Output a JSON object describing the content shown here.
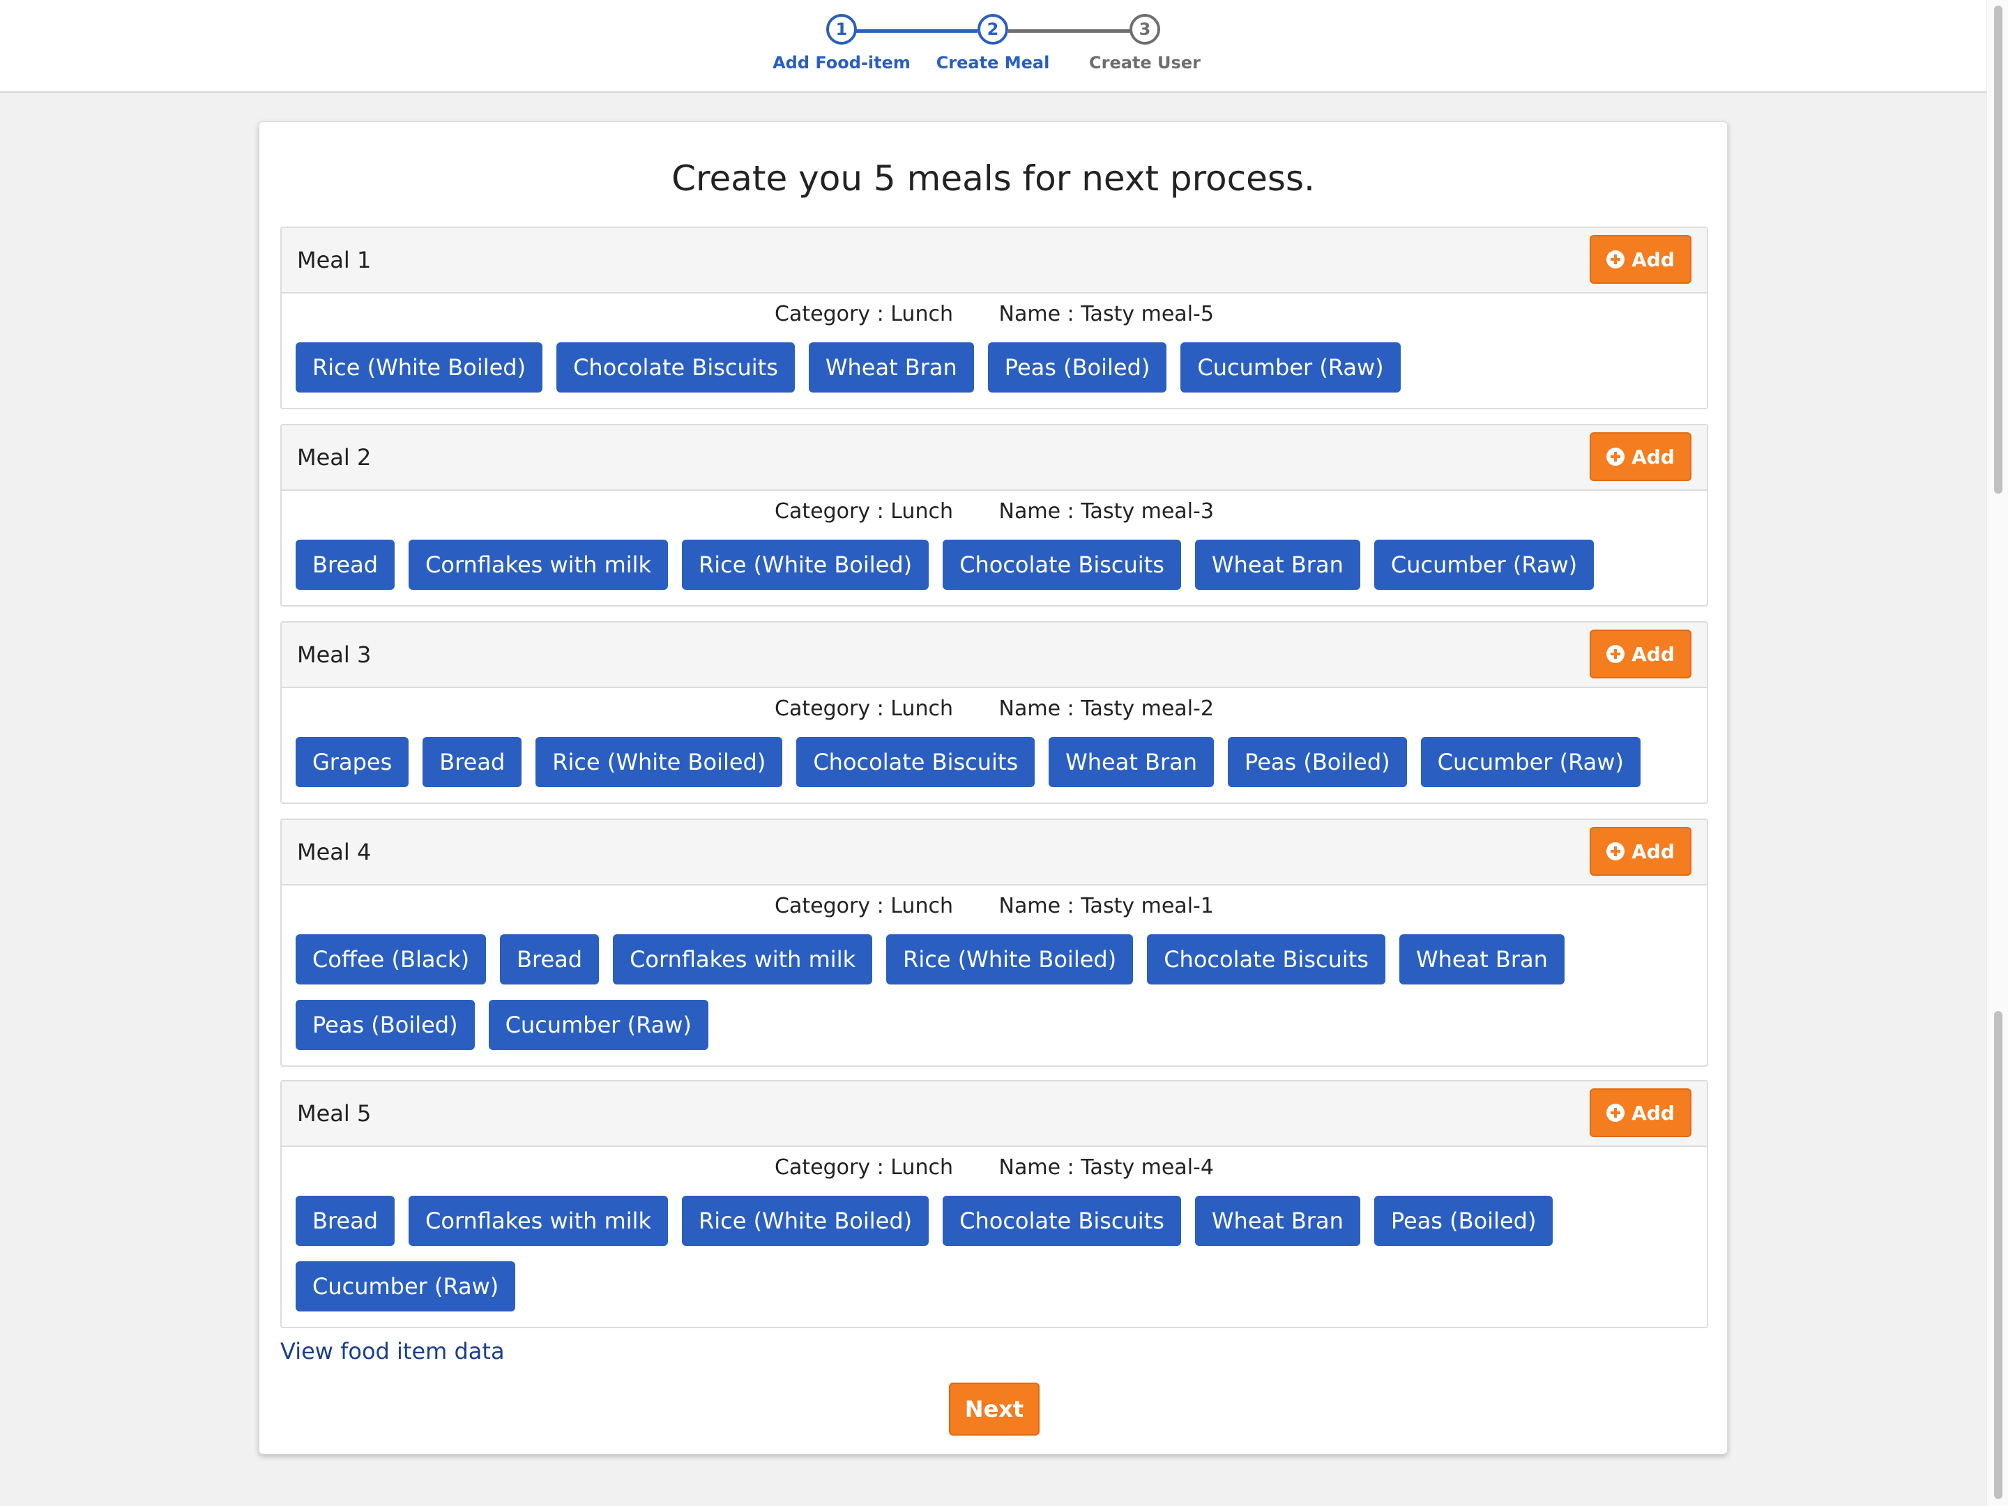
{
  "stepper": {
    "steps": [
      {
        "number": "1",
        "label": "Add Food-item",
        "state": "completed"
      },
      {
        "number": "2",
        "label": "Create Meal",
        "state": "active"
      },
      {
        "number": "3",
        "label": "Create User",
        "state": "inactive"
      }
    ]
  },
  "page": {
    "title": "Create you 5 meals for next process.",
    "add_label": "Add",
    "view_link": "View food item data",
    "next_label": "Next"
  },
  "meals": [
    {
      "title": "Meal 1",
      "category": "Category : Lunch",
      "name": "Name : Tasty meal-5",
      "items": [
        "Rice (White Boiled)",
        "Chocolate Biscuits",
        "Wheat Bran",
        "Peas (Boiled)",
        "Cucumber (Raw)"
      ]
    },
    {
      "title": "Meal 2",
      "category": "Category : Lunch",
      "name": "Name : Tasty meal-3",
      "items": [
        "Bread",
        "Cornflakes with milk",
        "Rice (White Boiled)",
        "Chocolate Biscuits",
        "Wheat Bran",
        "Cucumber (Raw)"
      ]
    },
    {
      "title": "Meal 3",
      "category": "Category : Lunch",
      "name": "Name : Tasty meal-2",
      "items": [
        "Grapes",
        "Bread",
        "Rice (White Boiled)",
        "Chocolate Biscuits",
        "Wheat Bran",
        "Peas (Boiled)",
        "Cucumber (Raw)"
      ]
    },
    {
      "title": "Meal 4",
      "category": "Category : Lunch",
      "name": "Name : Tasty meal-1",
      "items": [
        "Coffee (Black)",
        "Bread",
        "Cornflakes with milk",
        "Rice (White Boiled)",
        "Chocolate Biscuits",
        "Wheat Bran",
        "Peas (Boiled)",
        "Cucumber (Raw)"
      ]
    },
    {
      "title": "Meal 5",
      "category": "Category : Lunch",
      "name": "Name : Tasty meal-4",
      "items": [
        "Bread",
        "Cornflakes with milk",
        "Rice (White Boiled)",
        "Chocolate Biscuits",
        "Wheat Bran",
        "Peas (Boiled)",
        "Cucumber (Raw)"
      ]
    }
  ],
  "colors": {
    "primary_blue": "#2a5fc1",
    "accent_orange": "#f47d20",
    "inactive_grey": "#6e6e6e"
  }
}
